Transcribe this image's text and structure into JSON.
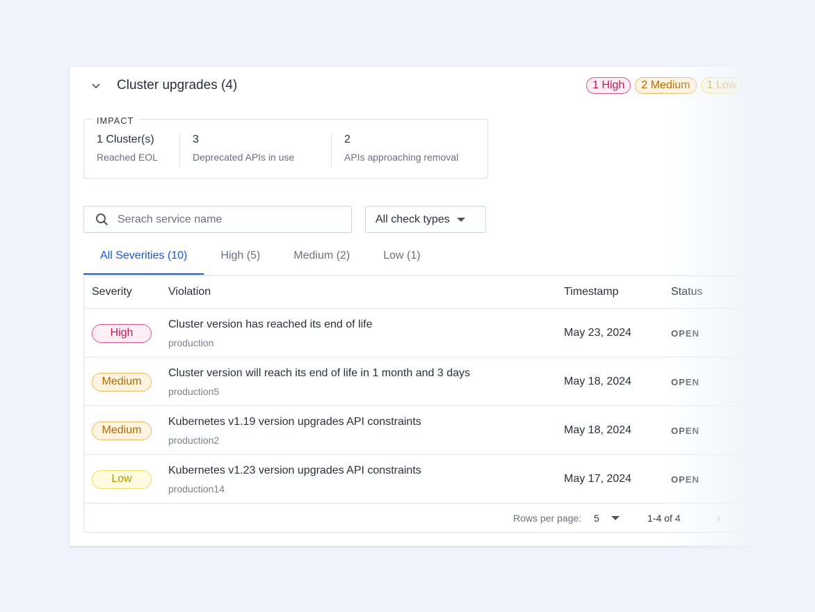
{
  "header": {
    "title": "Cluster upgrades (4)",
    "pills": [
      {
        "label": "1 High",
        "color": "#c2185b",
        "bg": "#fdeef4"
      },
      {
        "label": "2 Medium",
        "color": "#b26a00",
        "bg": "#fff4e0"
      },
      {
        "label": "1 Low",
        "color": "#c9a800",
        "bg": "#fffbe0"
      }
    ]
  },
  "impact": {
    "label": "IMPACT",
    "stats": [
      {
        "value": "1 Cluster(s)",
        "label": "Reached EOL"
      },
      {
        "value": "3",
        "label": "Deprecated APIs in use"
      },
      {
        "value": "2",
        "label": "APIs approaching removal"
      }
    ]
  },
  "search": {
    "placeholder": "Serach service name"
  },
  "filter": {
    "value": "All check types"
  },
  "tabs": [
    {
      "label": "All Severities (10)"
    },
    {
      "label": "High (5)"
    },
    {
      "label": "Medium (2)"
    },
    {
      "label": "Low (1)"
    }
  ],
  "table": {
    "columns": [
      "Severity",
      "Violation",
      "Timestamp",
      "Status"
    ],
    "rows": [
      {
        "severity": "High",
        "violation": "Cluster version has reached its end of life",
        "service": "production",
        "timestamp": "May 23, 2024",
        "status": "OPEN"
      },
      {
        "severity": "Medium",
        "violation": "Cluster version will reach its end of life in 1 month and 3 days",
        "service": "production5",
        "timestamp": "May 18, 2024",
        "status": "OPEN"
      },
      {
        "severity": "Medium",
        "violation": "Kubernetes v1.19 version upgrades API constraints",
        "service": "production2",
        "timestamp": "May 18, 2024",
        "status": "OPEN"
      },
      {
        "severity": "Low",
        "violation": "Kubernetes v1.23 version upgrades API constraints",
        "service": "production14",
        "timestamp": "May 17, 2024",
        "status": "OPEN"
      }
    ]
  },
  "pagination": {
    "rows_label": "Rows per page:",
    "rows_value": "5",
    "range": "1-4 of 4"
  },
  "colors": {
    "High": "#c2185b",
    "Medium": "#b26a00",
    "Low": "#b59a00",
    "accent": "#1a56db"
  }
}
